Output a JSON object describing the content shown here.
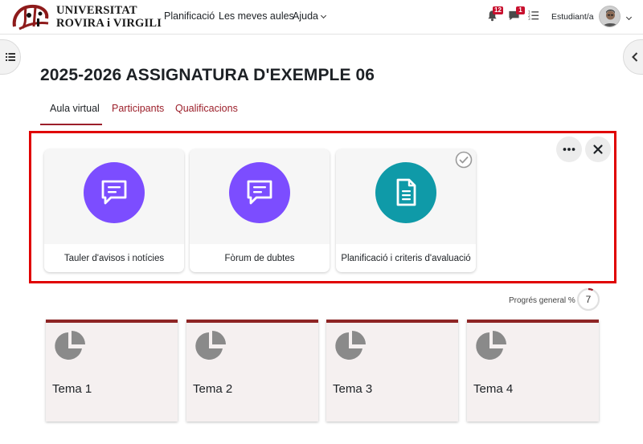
{
  "brand": {
    "line1": "UNIVERSITAT",
    "line2": "ROVIRA i VIRGILI"
  },
  "nav": {
    "links": [
      "Planificació",
      "Les meves aules",
      "Ajuda"
    ],
    "notifications_count": "12",
    "messages_count": "1",
    "user_role": "Estudiant/a"
  },
  "course": {
    "title": "2025-2026 ASSIGNATURA D'EXEMPLE 06"
  },
  "tabs": [
    "Aula virtual",
    "Participants",
    "Qualificacions"
  ],
  "activities": [
    {
      "label": "Tauler d'avisos i notícies",
      "icon": "forum-icon",
      "color": "#7c4dff"
    },
    {
      "label": "Fòrum de dubtes",
      "icon": "forum-icon",
      "color": "#7c4dff"
    },
    {
      "label": "Planificació i criteris d'avaluació",
      "icon": "document-icon",
      "color": "#0f9aa8"
    }
  ],
  "progress": {
    "label": "Progrés general %",
    "value": "7"
  },
  "topics": [
    "Tema 1",
    "Tema 2",
    "Tema 3",
    "Tema 4"
  ],
  "colors": {
    "accent": "#9c1f2a",
    "highlight": "#e00000",
    "badge": "#c8102e"
  }
}
